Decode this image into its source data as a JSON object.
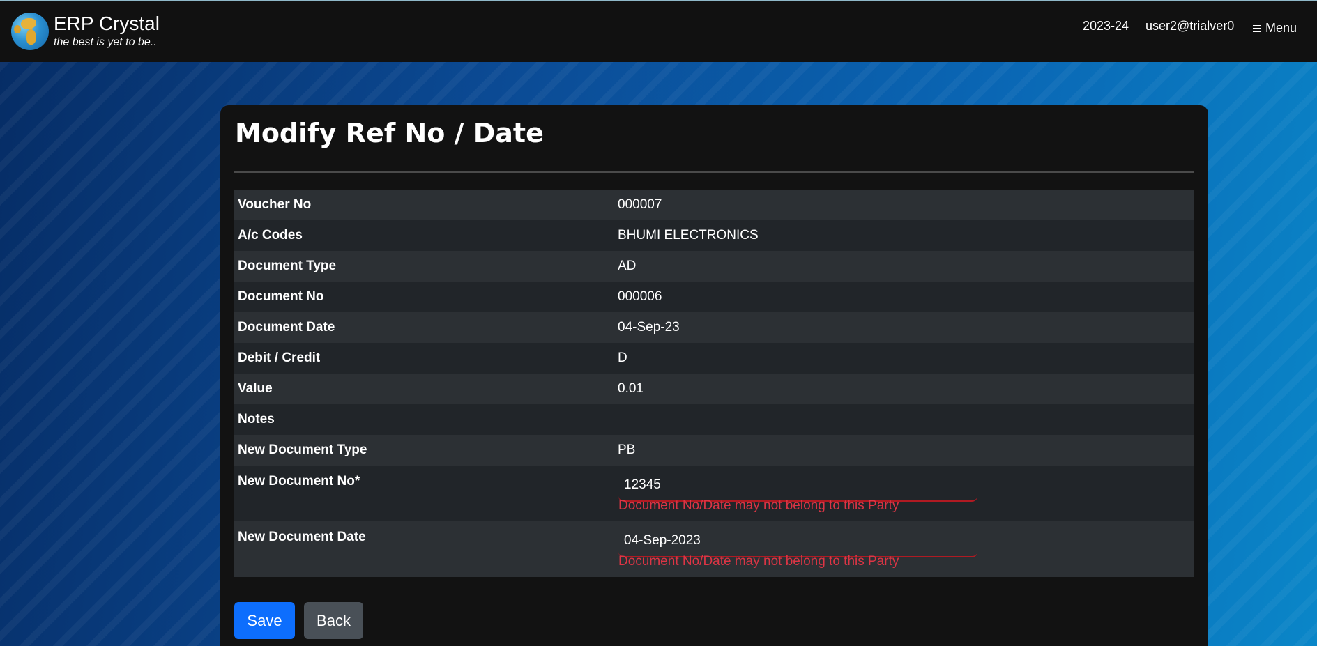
{
  "header": {
    "title": "ERP Crystal",
    "tagline": "the best is yet to be..",
    "year": "2023-24",
    "user": "user2@trialver0",
    "menu_label": "Menu"
  },
  "page": {
    "title": "Modify Ref No / Date"
  },
  "details": [
    {
      "label": "Voucher No",
      "value": "000007"
    },
    {
      "label": "A/c Codes",
      "value": "BHUMI ELECTRONICS"
    },
    {
      "label": "Document Type",
      "value": "AD"
    },
    {
      "label": "Document No",
      "value": "000006"
    },
    {
      "label": "Document Date",
      "value": "04-Sep-23"
    },
    {
      "label": "Debit / Credit",
      "value": "D"
    },
    {
      "label": "Value",
      "value": "0.01"
    },
    {
      "label": "Notes",
      "value": ""
    },
    {
      "label": "New Document Type",
      "value": "PB"
    }
  ],
  "new_doc_no": {
    "label": "New Document No*",
    "value": "12345",
    "error": "Document No/Date may not belong to this Party"
  },
  "new_doc_date": {
    "label": "New Document Date",
    "value": "04-Sep-2023",
    "error": "Document No/Date may not belong to this Party"
  },
  "buttons": {
    "save": "Save",
    "back": "Back"
  },
  "colors": {
    "primary": "#0d6efd",
    "secondary": "#495057",
    "error": "#dc3545",
    "navbar": "#111111"
  }
}
